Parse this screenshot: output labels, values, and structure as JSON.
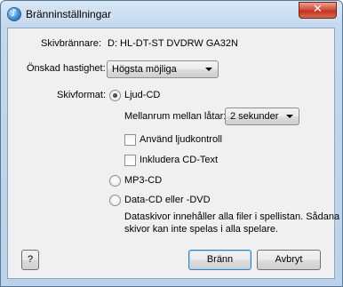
{
  "window": {
    "title": "Bränninställningar",
    "close_label": "✕"
  },
  "burner": {
    "label": "Skivbrännare:",
    "value": "D: HL-DT-ST DVDRW  GA32N"
  },
  "speed": {
    "label": "Önskad hastighet:",
    "selected": "Högsta möjliga"
  },
  "format": {
    "label": "Skivformat:",
    "options": [
      {
        "label": "Ljud-CD",
        "checked": true
      },
      {
        "label": "MP3-CD",
        "checked": false
      },
      {
        "label": "Data-CD eller -DVD",
        "checked": false
      }
    ],
    "gap_label": "Mellanrum mellan låtar:",
    "gap_selected": "2 sekunder",
    "volume_check_label": "Använd ljudkontroll",
    "cdtext_label": "Inkludera CD-Text",
    "data_note_line1": "Dataskivor innehåller alla filer i spellistan. Sådana",
    "data_note_line2": "skivor kan inte spelas i alla spelare."
  },
  "buttons": {
    "help": "?",
    "burn": "Bränn",
    "cancel": "Avbryt"
  }
}
